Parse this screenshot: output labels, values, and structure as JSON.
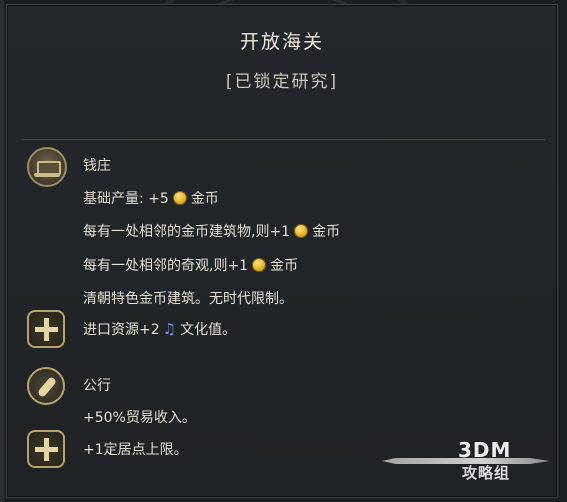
{
  "tooltip": {
    "title": "开放海关",
    "status": "[已锁定研究]"
  },
  "effects": [
    {
      "icon": "bank-icon",
      "lines": [
        "钱庄"
      ]
    }
  ],
  "lines": {
    "bank_name": "钱庄",
    "base_output_prefix": "基础产量: +5",
    "gold": "金币",
    "adjacent_gold_building_prefix": "每有一处相邻的金币建筑物,则+1",
    "adjacent_wonder_prefix": "每有一处相邻的奇观,则+1",
    "qing_note": "清朝特色金币建筑。无时代限制。",
    "import_prefix": "进口资源+2",
    "culture": "文化值。",
    "firm_name": "公行",
    "trade_income": "+50%贸易收入。",
    "settlement_limit": "+1定居点上限。"
  },
  "icons": {
    "gold": "gold-coin-icon",
    "culture": "music-note-icon",
    "plus": "plus-icon",
    "trade": "quill-icon"
  },
  "watermark": {
    "logo": "3DM",
    "group": "攻略组"
  },
  "colors": {
    "panel_bg": "#23272b",
    "text": "#e4dfd3",
    "gold": "#e0b22a",
    "culture": "#6f8fe0"
  }
}
